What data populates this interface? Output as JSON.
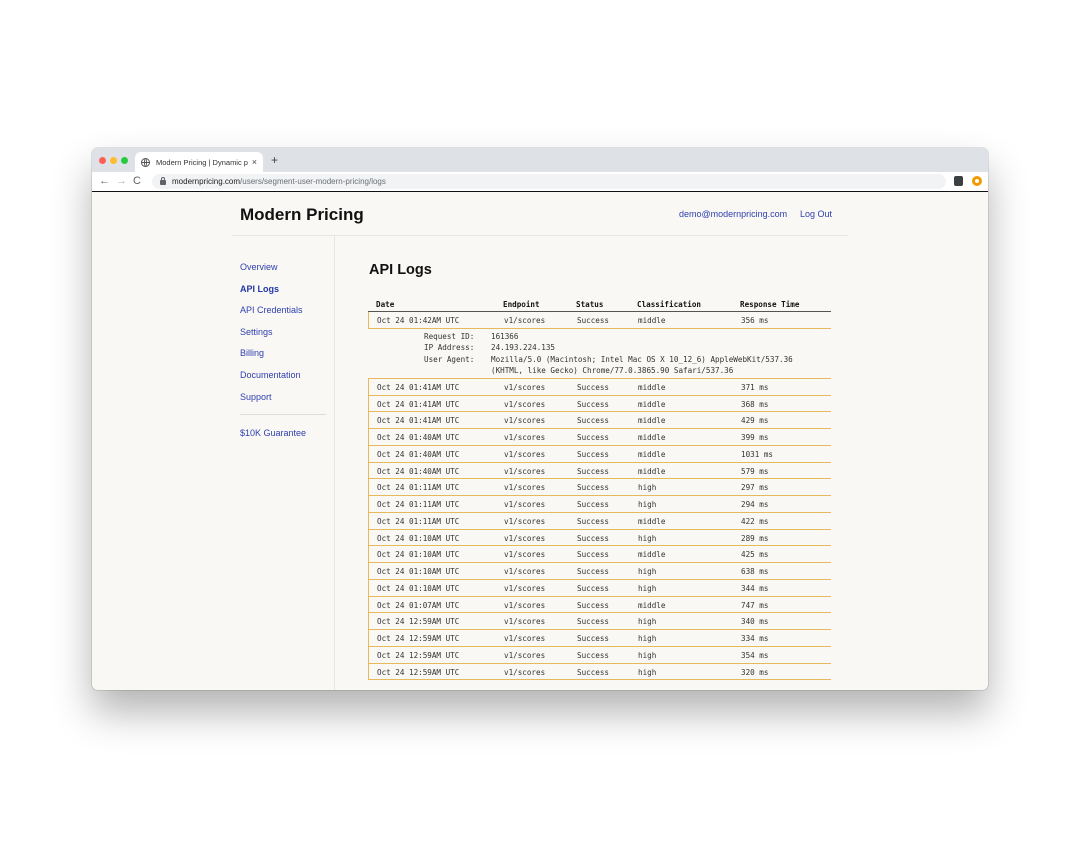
{
  "browser": {
    "tab_title": "Modern Pricing | Dynamic prici",
    "tab_close": "×",
    "new_tab": "+",
    "url_host": "modernpricing.com",
    "url_path": "/users/segment-user-modern-pricing/logs",
    "nav_back": "←",
    "nav_forward": "→",
    "nav_reload": "C"
  },
  "header": {
    "brand": "Modern Pricing",
    "email": "demo@modernpricing.com",
    "logout": "Log Out"
  },
  "sidebar": {
    "items": [
      "Overview",
      "API Logs",
      "API Credentials",
      "Settings",
      "Billing",
      "Documentation",
      "Support"
    ],
    "active_index": 1,
    "guarantee": "$10K Guarantee"
  },
  "main": {
    "title": "API Logs",
    "columns": [
      "Date",
      "Endpoint",
      "Status",
      "Classification",
      "Response Time"
    ],
    "expanded": {
      "labels": [
        "Request ID:",
        "IP Address:",
        "User Agent:"
      ],
      "request_id": "161366",
      "ip": "24.193.224.135",
      "user_agent_1": "Mozilla/5.0 (Macintosh; Intel Mac OS X 10_12_6) AppleWebKit/537.36",
      "user_agent_2": "(KHTML, like Gecko) Chrome/77.0.3865.90 Safari/537.36"
    },
    "rows": [
      [
        "Oct 24 01:42AM UTC",
        "v1/scores",
        "Success",
        "middle",
        "356 ms"
      ],
      [
        "Oct 24 01:41AM UTC",
        "v1/scores",
        "Success",
        "middle",
        "371 ms"
      ],
      [
        "Oct 24 01:41AM UTC",
        "v1/scores",
        "Success",
        "middle",
        "368 ms"
      ],
      [
        "Oct 24 01:41AM UTC",
        "v1/scores",
        "Success",
        "middle",
        "429 ms"
      ],
      [
        "Oct 24 01:40AM UTC",
        "v1/scores",
        "Success",
        "middle",
        "399 ms"
      ],
      [
        "Oct 24 01:40AM UTC",
        "v1/scores",
        "Success",
        "middle",
        "1031 ms"
      ],
      [
        "Oct 24 01:40AM UTC",
        "v1/scores",
        "Success",
        "middle",
        "579 ms"
      ],
      [
        "Oct 24 01:11AM UTC",
        "v1/scores",
        "Success",
        "high",
        "297 ms"
      ],
      [
        "Oct 24 01:11AM UTC",
        "v1/scores",
        "Success",
        "high",
        "294 ms"
      ],
      [
        "Oct 24 01:11AM UTC",
        "v1/scores",
        "Success",
        "middle",
        "422 ms"
      ],
      [
        "Oct 24 01:10AM UTC",
        "v1/scores",
        "Success",
        "high",
        "289 ms"
      ],
      [
        "Oct 24 01:10AM UTC",
        "v1/scores",
        "Success",
        "middle",
        "425 ms"
      ],
      [
        "Oct 24 01:10AM UTC",
        "v1/scores",
        "Success",
        "high",
        "638 ms"
      ],
      [
        "Oct 24 01:10AM UTC",
        "v1/scores",
        "Success",
        "high",
        "344 ms"
      ],
      [
        "Oct 24 01:07AM UTC",
        "v1/scores",
        "Success",
        "middle",
        "747 ms"
      ],
      [
        "Oct 24 12:59AM UTC",
        "v1/scores",
        "Success",
        "high",
        "340 ms"
      ],
      [
        "Oct 24 12:59AM UTC",
        "v1/scores",
        "Success",
        "high",
        "334 ms"
      ],
      [
        "Oct 24 12:59AM UTC",
        "v1/scores",
        "Success",
        "high",
        "354 ms"
      ],
      [
        "Oct 24 12:59AM UTC",
        "v1/scores",
        "Success",
        "high",
        "320 ms"
      ]
    ]
  },
  "colors": {
    "link": "#2d3fae",
    "row_accent": "#e7b95d",
    "page_bg": "#faf8f5"
  },
  "icons": [
    "globe-icon",
    "back-arrow-icon",
    "forward-arrow-icon",
    "reload-icon",
    "lock-icon",
    "extension-icon",
    "profile-icon"
  ]
}
